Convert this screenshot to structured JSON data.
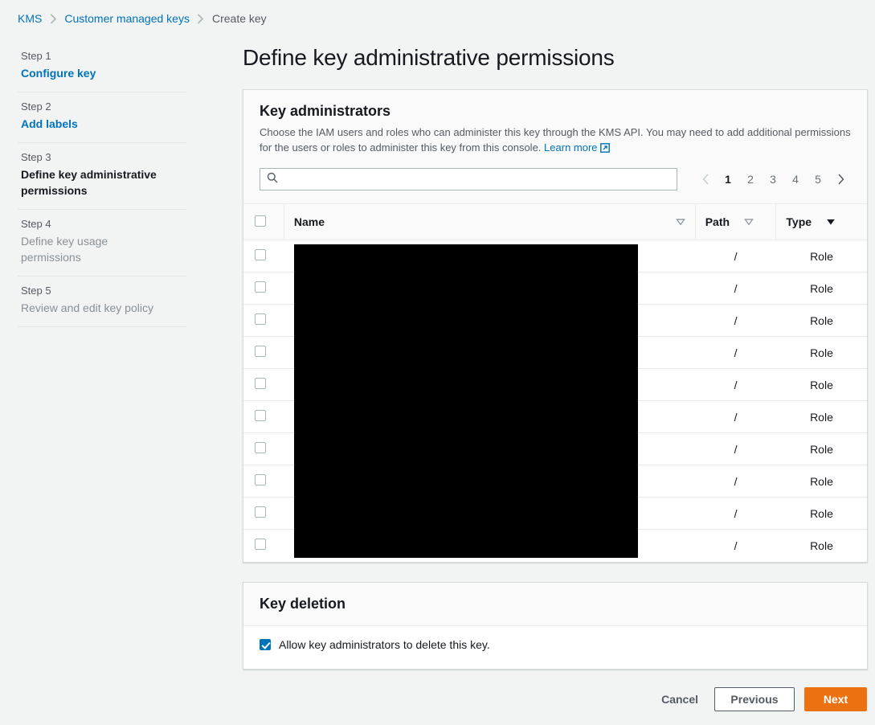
{
  "breadcrumb": {
    "items": [
      {
        "label": "KMS",
        "type": "link"
      },
      {
        "label": "Customer managed keys",
        "type": "link"
      },
      {
        "label": "Create key",
        "type": "current"
      }
    ]
  },
  "sidebar": {
    "steps": [
      {
        "num": "Step 1",
        "title": "Configure key",
        "state": "link"
      },
      {
        "num": "Step 2",
        "title": "Add labels",
        "state": "link"
      },
      {
        "num": "Step 3",
        "title": "Define key administrative permissions",
        "state": "active"
      },
      {
        "num": "Step 4",
        "title": "Define key usage permissions",
        "state": "muted"
      },
      {
        "num": "Step 5",
        "title": "Review and edit key policy",
        "state": "muted"
      }
    ]
  },
  "page": {
    "title": "Define key administrative permissions"
  },
  "admins_card": {
    "title": "Key administrators",
    "description": "Choose the IAM users and roles who can administer this key through the KMS API. You may need to add additional permissions for the users or roles to administer this key from this console.",
    "learn_more": "Learn more",
    "learn_more_icon": "external-link-icon"
  },
  "search": {
    "icon": "search-icon",
    "value": "",
    "placeholder": ""
  },
  "pagination": {
    "prev_icon": "chevron-left-icon",
    "next_icon": "chevron-right-icon",
    "pages": [
      "1",
      "2",
      "3",
      "4",
      "5"
    ],
    "current": "1"
  },
  "table": {
    "select_all_checked": false,
    "columns": [
      {
        "key": "name",
        "label": "Name",
        "sort_icon": "sort-caret-hollow",
        "sorted": false
      },
      {
        "key": "path",
        "label": "Path",
        "sort_icon": "sort-caret-hollow",
        "sorted": false
      },
      {
        "key": "type",
        "label": "Type",
        "sort_icon": "sort-caret-solid",
        "sorted": true
      }
    ],
    "rows": [
      {
        "checked": false,
        "name": "",
        "path": "/",
        "type": "Role"
      },
      {
        "checked": false,
        "name": "",
        "path": "/",
        "type": "Role"
      },
      {
        "checked": false,
        "name": "",
        "path": "/",
        "type": "Role"
      },
      {
        "checked": false,
        "name": "",
        "path": "/",
        "type": "Role"
      },
      {
        "checked": false,
        "name": "",
        "path": "/",
        "type": "Role"
      },
      {
        "checked": false,
        "name": "",
        "path": "/",
        "type": "Role"
      },
      {
        "checked": false,
        "name": "",
        "path": "/",
        "type": "Role"
      },
      {
        "checked": false,
        "name": "",
        "path": "/",
        "type": "Role"
      },
      {
        "checked": false,
        "name": "",
        "path": "/",
        "type": "Role"
      },
      {
        "checked": false,
        "name": "",
        "path": "/",
        "type": "Role"
      }
    ],
    "name_column_redacted": true
  },
  "deletion_card": {
    "title": "Key deletion",
    "checkbox_label": "Allow key administrators to delete this key.",
    "checkbox_checked": true
  },
  "footer": {
    "cancel": "Cancel",
    "previous": "Previous",
    "next": "Next"
  },
  "colors": {
    "link": "#0073bb",
    "primary": "#ec7211",
    "page_bg": "#f2f3f3",
    "card_bg": "#ffffff",
    "redaction": "#000000"
  }
}
